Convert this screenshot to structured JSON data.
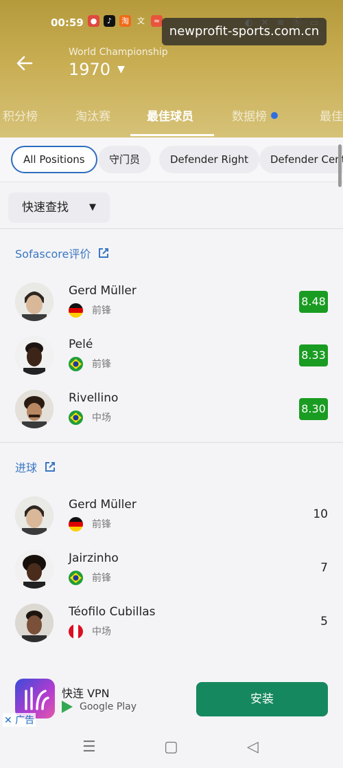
{
  "status_bar": {
    "time": "00:59",
    "icons": "◐ ✕ ≋ ⓗ ▭"
  },
  "watermark": "newprofit-sports.com.cn",
  "header": {
    "league": "World Championship",
    "season": "1970"
  },
  "tabs": [
    {
      "label": "积分榜"
    },
    {
      "label": "淘汰赛"
    },
    {
      "label": "最佳球员",
      "active": true
    },
    {
      "label": "数据榜",
      "dot": true
    },
    {
      "label": "最佳"
    }
  ],
  "chips": [
    {
      "label": "All Positions",
      "active": true
    },
    {
      "label": "守门员"
    },
    {
      "label": "Defender Right"
    },
    {
      "label": "Defender Center"
    }
  ],
  "quick_search": {
    "label": "快速查找"
  },
  "sections": [
    {
      "title": "Sofascore评价",
      "players": [
        {
          "name": "Gerd Müller",
          "position": "前锋",
          "country": "germany",
          "value": "8.48"
        },
        {
          "name": "Pelé",
          "position": "前锋",
          "country": "brazil",
          "value": "8.33"
        },
        {
          "name": "Rivellino",
          "position": "中场",
          "country": "brazil",
          "value": "8.30"
        }
      ]
    },
    {
      "title": "进球",
      "players": [
        {
          "name": "Gerd Müller",
          "position": "前锋",
          "country": "germany",
          "value": "10"
        },
        {
          "name": "Jairzinho",
          "position": "前锋",
          "country": "brazil",
          "value": "7"
        },
        {
          "name": "Téofilo Cubillas",
          "position": "中场",
          "country": "peru",
          "value": "5"
        }
      ]
    }
  ],
  "ad": {
    "title": "快连 VPN",
    "store": "Google Play",
    "close": "✕ 广告",
    "button": "安装"
  },
  "colors": {
    "rating_green": "#1a9c22",
    "accent_blue": "#3a77c2",
    "install_green": "#168860"
  }
}
